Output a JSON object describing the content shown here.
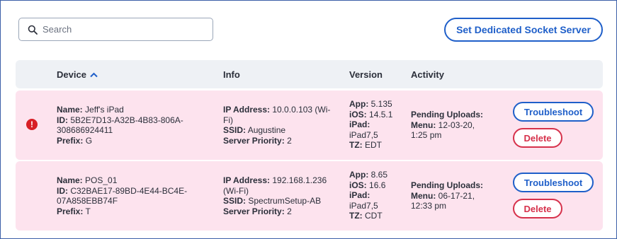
{
  "search": {
    "placeholder": "Search",
    "value": ""
  },
  "header_button": {
    "label": "Set Dedicated Socket Server"
  },
  "table": {
    "columns": {
      "device": "Device",
      "info": "Info",
      "version": "Version",
      "activity": "Activity"
    },
    "sort": {
      "column": "Device",
      "direction": "ascending",
      "icon": "chevron-up-icon"
    },
    "labels": {
      "name": "Name:",
      "id": "ID:",
      "prefix": "Prefix:",
      "ip": "IP Address:",
      "ssid": "SSID:",
      "priority": "Server Priority:",
      "app": "App:",
      "ios": "iOS:",
      "ipad": "iPad:",
      "tz": "TZ:",
      "pending": "Pending Uploads:",
      "menu": "Menu:"
    },
    "rows": [
      {
        "alert": "!",
        "name": "Jeff's iPad",
        "id_line1": "5B2E7D13-A32B-4B83-806A-",
        "id_line2": "308686924411",
        "prefix": "G",
        "ip_line1": "10.0.0.103 (Wi-",
        "ip_line2": "Fi)",
        "ssid": "Augustine",
        "priority": "2",
        "app": "5.135",
        "ios": "14.5.1",
        "ipad": "iPad7,5",
        "tz": "EDT",
        "menu_line1": "12-03-20,",
        "menu_line2": "1:25 pm",
        "troubleshoot": "Troubleshoot",
        "delete": "Delete"
      },
      {
        "name": "POS_01",
        "id_line1": "C32BAE17-89BD-4E44-BC4E-",
        "id_line2": "07A858EBB74F",
        "prefix": "T",
        "ip_line1": "192.168.1.236",
        "ip_line2": "(Wi-Fi)",
        "ssid": "SpectrumSetup-AB",
        "priority": "2",
        "app": "8.65",
        "ios": "16.6",
        "ipad": "iPad7,5",
        "tz": "CDT",
        "menu_line1": "06-17-21,",
        "menu_line2": "12:33 pm",
        "troubleshoot": "Troubleshoot",
        "delete": "Delete"
      }
    ]
  },
  "colors": {
    "accent": "#1f5fc9",
    "danger": "#d6314b",
    "row_bg": "#fde3ee",
    "header_bg": "#eef1f5",
    "alert": "#d81f26"
  }
}
